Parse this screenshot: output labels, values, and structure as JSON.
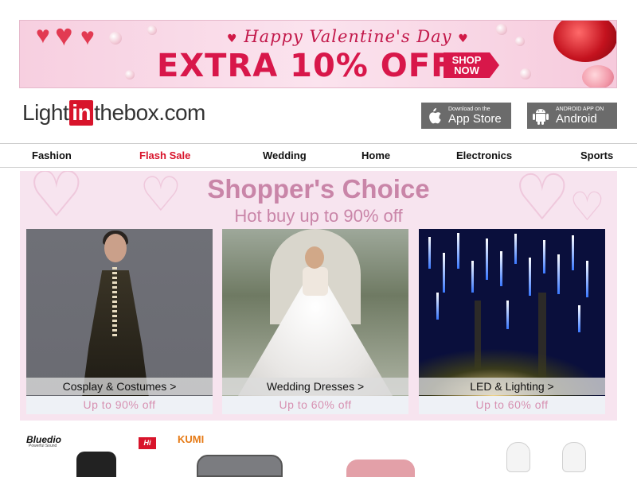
{
  "banner": {
    "tagline": "Happy Valentine's Day",
    "offer": "EXTRA 10% OFF",
    "shop_now_line1": "SHOP",
    "shop_now_line2": "NOW",
    "colors": {
      "accent": "#d8174a",
      "background": "#f7cfe0"
    }
  },
  "header": {
    "logo": {
      "part1": "Light",
      "part2": "in",
      "part3": "thebox",
      "part4": ".com"
    },
    "app_store": {
      "small": "Download on the",
      "big": "App Store",
      "icon": "apple-icon"
    },
    "android": {
      "small": "ANDROID APP ON",
      "big": "Android",
      "icon": "android-icon"
    }
  },
  "nav": {
    "items": [
      "Fashion",
      "Flash Sale",
      "Wedding",
      "Home",
      "Electronics",
      "Sports"
    ],
    "highlight_color": "#d8142b"
  },
  "choice": {
    "title": "Shopper's Choice",
    "subtitle": "Hot buy up to 90% off",
    "cards": [
      {
        "label": "Cosplay & Costumes >",
        "discount": "Up to 90% off"
      },
      {
        "label": "Wedding Dresses >",
        "discount": "Up to 60% off"
      },
      {
        "label": "LED & Lighting >",
        "discount": "Up to 60% off"
      }
    ]
  },
  "brands": {
    "bluedio": "Bluedio",
    "bluedio_sub": "Powerful Sound",
    "hi": "Hi",
    "kumi": "KUMI"
  }
}
